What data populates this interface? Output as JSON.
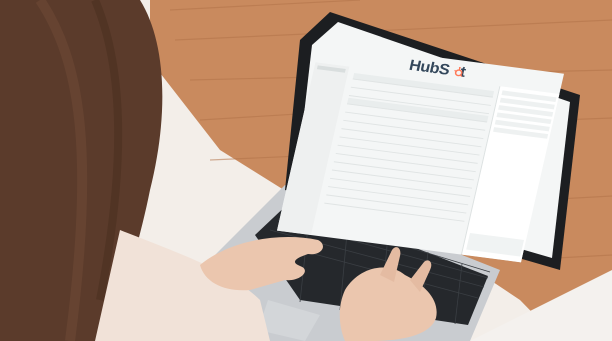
{
  "scene": {
    "description_free": true,
    "colors": {
      "background_wall": "#f2ede8",
      "wood_floor": "#c6865a",
      "wood_floor_dark": "#a8683f",
      "hair": "#5a3a2a",
      "skin": "#e9c4ad",
      "laptop_body": "#c7cacd",
      "laptop_bezel": "#1d1f22",
      "keyboard": "#232629",
      "screen_bg": "#f4f6f6",
      "brand_orange": "#ff7a59",
      "brand_navy": "#33475b"
    }
  },
  "screen": {
    "logo_text_left": "HubS",
    "logo_text_right": "t",
    "nav": [
      "",
      "",
      ""
    ],
    "sidebar_items": [
      "",
      "",
      ""
    ],
    "main_title": "",
    "rows": [
      "",
      "",
      "",
      "",
      "",
      "",
      "",
      "",
      "",
      "",
      "",
      "",
      "",
      "",
      "",
      ""
    ],
    "panel_title": "",
    "panel_cta": ""
  }
}
